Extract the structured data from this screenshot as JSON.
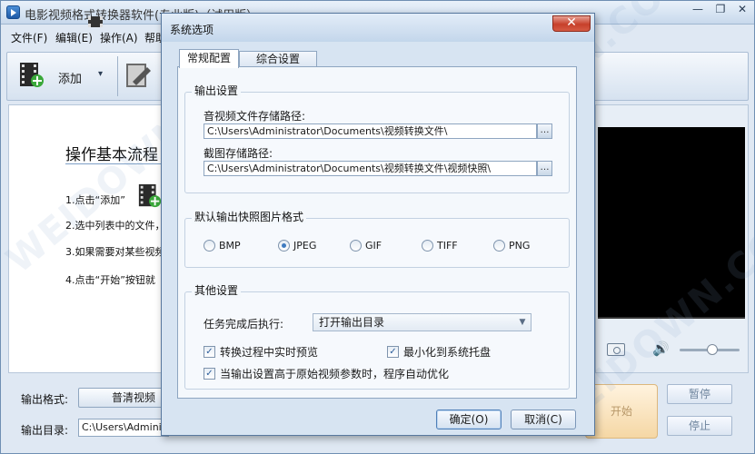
{
  "main_window": {
    "title": "电影视频格式转换器软件(专业版)（试用版）",
    "controls": {
      "minimize": "—",
      "restore": "❐",
      "close": "✕"
    }
  },
  "menu": [
    {
      "label": "文件(F)"
    },
    {
      "label": "编辑(E)"
    },
    {
      "label": "操作(A)"
    },
    {
      "label": "帮助"
    }
  ],
  "toolbar": {
    "add_label": "添加",
    "add_icon": "film-add-icon",
    "edit_icon": "film-edit-icon",
    "dropdown_arrow": "▾"
  },
  "guide": {
    "title": "操作基本流程：",
    "steps": [
      "1.点击“添加”",
      "2.选中列表中的文件，",
      "3.如果需要对某些视频",
      "4.点击“开始”按钮就"
    ]
  },
  "player": {
    "volume_icon": "🔊",
    "volume_level": 0.55
  },
  "bottom": {
    "format_label": "输出格式:",
    "format_value": "普清视频",
    "outdir_label": "输出目录:",
    "outdir_value": "C:\\Users\\Administrator",
    "start_label": "开始",
    "pause_label": "暂停",
    "stop_label": "停止"
  },
  "watermark_text": "WEIDOWN.COM",
  "dialog": {
    "title": "系统选项",
    "close": "✕",
    "tabs": [
      {
        "label": "常规配置",
        "active": true
      },
      {
        "label": "综合设置",
        "active": false
      }
    ],
    "output_group": {
      "legend": "输出设置",
      "av_path_label": "音视频文件存储路径:",
      "av_path_value": "C:\\Users\\Administrator\\Documents\\视频转换文件\\",
      "snap_path_label": "截图存储路径:",
      "snap_path_value": "C:\\Users\\Administrator\\Documents\\视频转换文件\\视频快照\\",
      "browse": "…"
    },
    "snapshot_format_group": {
      "legend": "默认输出快照图片格式",
      "options": [
        {
          "label": "BMP",
          "selected": false
        },
        {
          "label": "JPEG",
          "selected": true
        },
        {
          "label": "GIF",
          "selected": false
        },
        {
          "label": "TIFF",
          "selected": false
        },
        {
          "label": "PNG",
          "selected": false
        }
      ]
    },
    "other_group": {
      "legend": "其他设置",
      "action_label": "任务完成后执行:",
      "action_value": "打开输出目录",
      "checks": [
        {
          "label": "转换过程中实时预览",
          "checked": true
        },
        {
          "label": "最小化到系统托盘",
          "checked": true
        },
        {
          "label": "当输出设置高于原始视频参数时，程序自动优化",
          "checked": true
        }
      ]
    },
    "ok_label": "确定(O)",
    "cancel_label": "取消(C)"
  },
  "colors": {
    "dialog_bg": "#d7e4f2",
    "close_red": "#c7402b",
    "radio_selected": "#3f7bc0",
    "start_button": "#f5d7a5"
  }
}
